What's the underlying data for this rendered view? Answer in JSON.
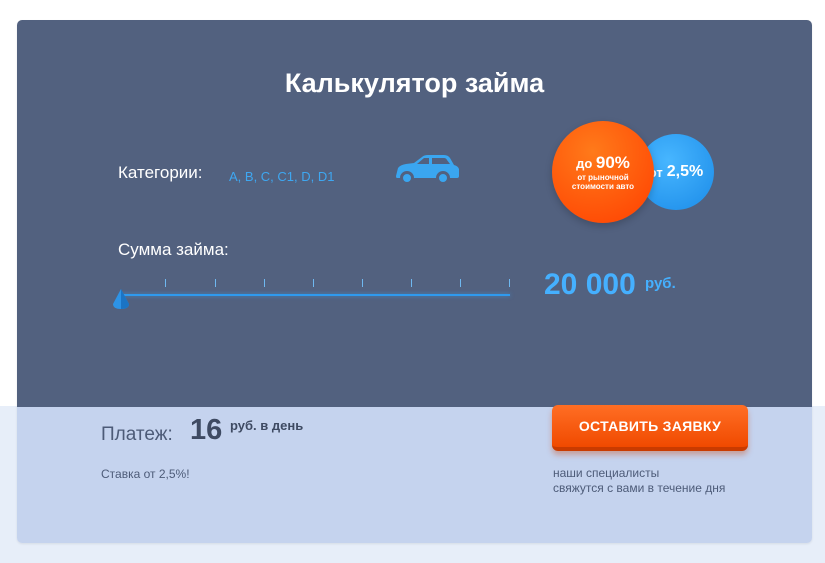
{
  "calculator": {
    "title": "Калькулятор займа",
    "categories_label": "Категории:",
    "categories_value": "A, B, C, C1, D, D1",
    "car_icon": "car-icon",
    "badge_orange": {
      "prefix": "до",
      "percent": "90%",
      "line2": "от рыночной",
      "line3": "стоимости авто"
    },
    "badge_blue": {
      "prefix": "от",
      "rate": "2,5%"
    },
    "sum_label": "Сумма займа:",
    "slider": {
      "amount": "20 000",
      "unit": "руб.",
      "position_fraction": 0
    },
    "payment": {
      "label": "Платеж:",
      "value": "16",
      "unit": "руб. в день",
      "rate_note": "Ставка от 2,5%!"
    },
    "cta": {
      "button_label": "ОСТАВИТЬ ЗАЯВКУ",
      "note_line1": "наши специалисты",
      "note_line2": "свяжутся с вами в течение дня"
    }
  },
  "colors": {
    "panel": "#52617f",
    "panel_bottom": "#c5d3ee",
    "accent_blue": "#45b0ff",
    "accent_orange": "#ff5a10"
  }
}
